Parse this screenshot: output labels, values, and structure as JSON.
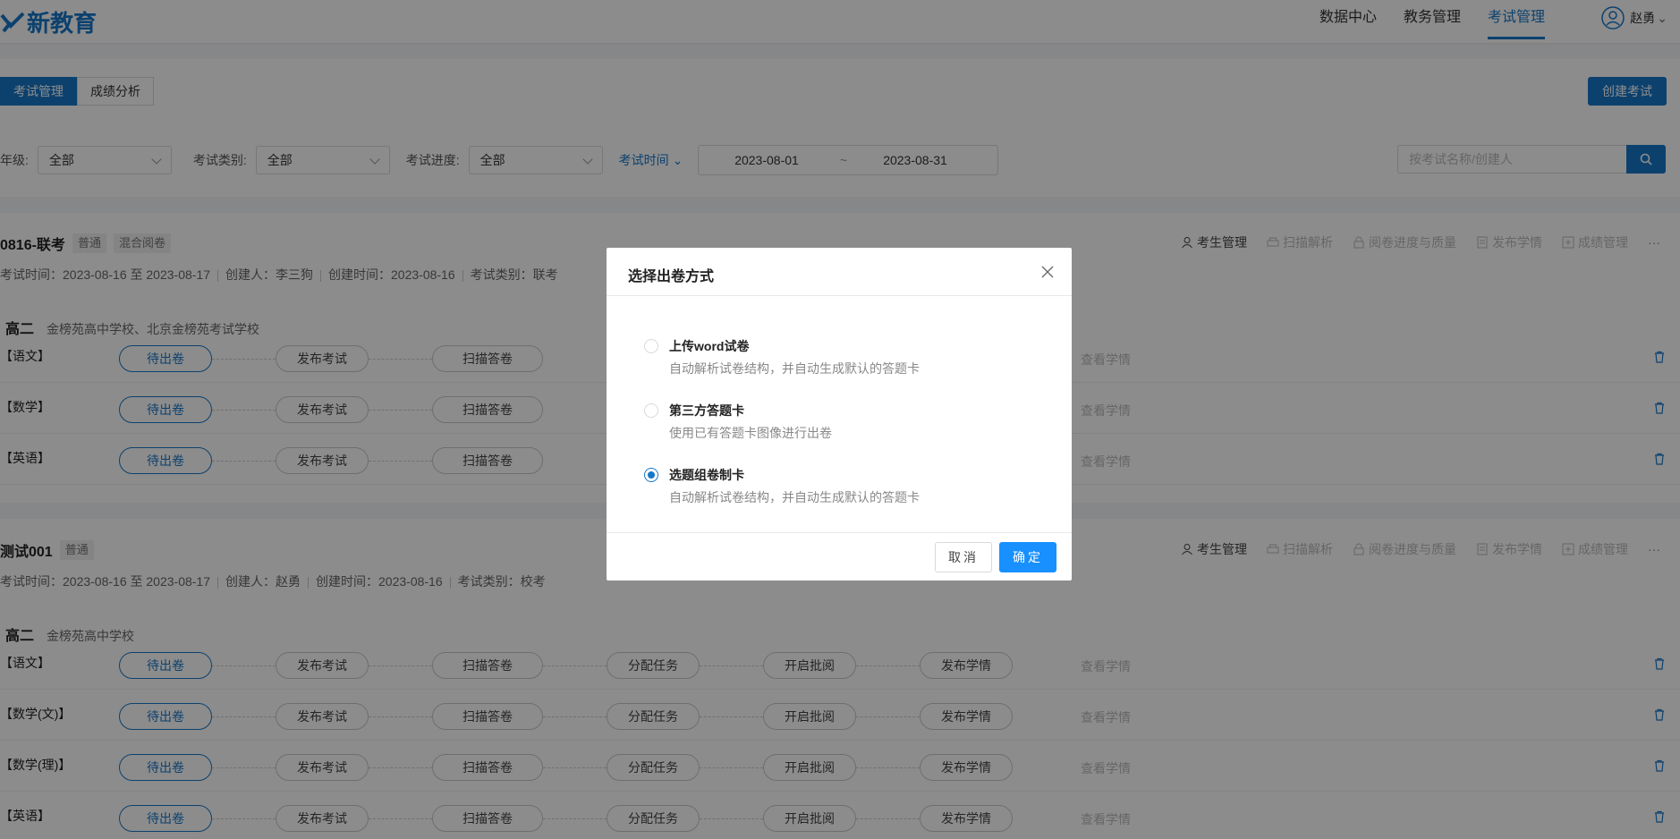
{
  "header": {
    "logo_text": "新教育",
    "nav": [
      "数据中心",
      "教务管理",
      "考试管理"
    ],
    "active_nav": "考试管理",
    "user": "赵勇"
  },
  "toolbar": {
    "tabs": [
      "考试管理",
      "成绩分析"
    ],
    "create_label": "创建考试"
  },
  "filters": {
    "grade_label": "年级:",
    "grade_value": "全部",
    "type_label": "考试类别:",
    "type_value": "全部",
    "progress_label": "考试进度:",
    "progress_value": "全部",
    "time_label": "考试时间",
    "date_start": "2023-08-01",
    "date_sep": "~",
    "date_end": "2023-08-31",
    "search_placeholder": "按考试名称/创建人"
  },
  "exam_actions": [
    "考生管理",
    "扫描解析",
    "阅卷进度与质量",
    "发布学情",
    "成绩管理"
  ],
  "exam1": {
    "title": "0816-联考",
    "tags": [
      "普通",
      "混合阅卷"
    ],
    "meta": [
      "考试时间：2023-08-16 至 2023-08-17",
      "创建人：李三狗",
      "创建时间：2023-08-16",
      "考试类别：联考"
    ],
    "grade": "高二",
    "schools": "金榜苑高中学校、北京金榜苑考试学校",
    "subjects": [
      "【语文】",
      "【数学】",
      "【英语】"
    ]
  },
  "exam2": {
    "title": "测试001",
    "tags": [
      "普通"
    ],
    "meta": [
      "考试时间：2023-08-16 至 2023-08-17",
      "创建人：赵勇",
      "创建时间：2023-08-16",
      "考试类别：校考"
    ],
    "grade": "高二",
    "schools": "金榜苑高中学校",
    "subjects": [
      "【语文】",
      "【数学(文)】",
      "【数学(理)】",
      "【英语】"
    ]
  },
  "steps": [
    "待出卷",
    "发布考试",
    "扫描答卷",
    "分配任务",
    "开启批阅",
    "发布学情"
  ],
  "view_label": "查看学情",
  "more_label": "···",
  "modal": {
    "title": "选择出卷方式",
    "options": [
      {
        "title": "上传word试卷",
        "desc": "自动解析试卷结构，并自动生成默认的答题卡",
        "selected": false
      },
      {
        "title": "第三方答题卡",
        "desc": "使用已有答题卡图像进行出卷",
        "selected": false
      },
      {
        "title": "选题组卷制卡",
        "desc": "自动解析试卷结构，并自动生成默认的答题卡",
        "selected": true
      }
    ],
    "cancel": "取消",
    "ok": "确定"
  },
  "colors": {
    "primary": "#1677c8",
    "overlay": "rgba(0,0,0,0.45)"
  }
}
